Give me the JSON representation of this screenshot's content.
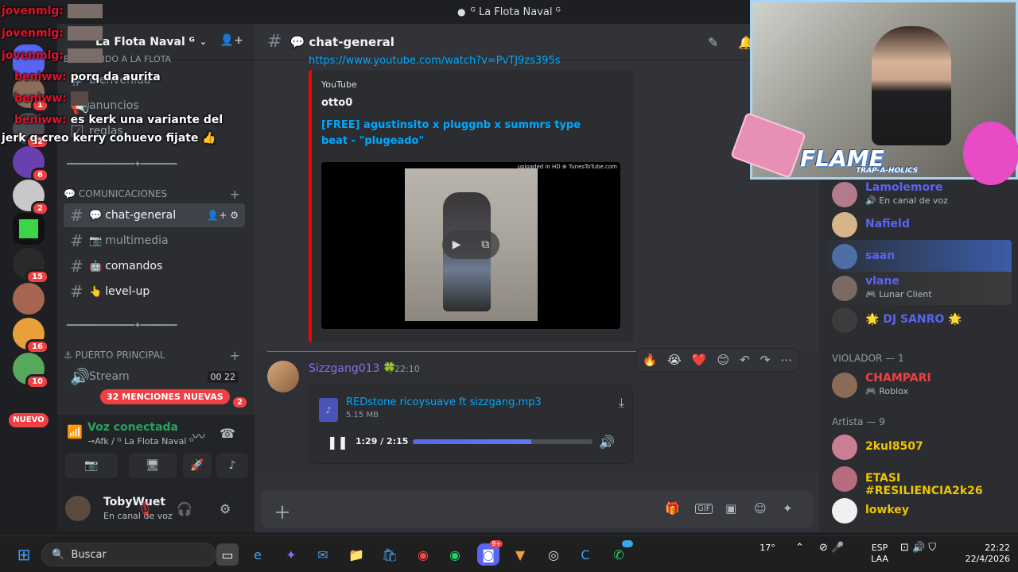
{
  "window": {
    "title": "ᴳ La Flota Naval ᴳ"
  },
  "server": {
    "name": "La Flota Naval ᴳ"
  },
  "guild_badges": [
    "1",
    "32",
    "6",
    "2",
    "15",
    "16",
    "10"
  ],
  "nuevo_label": "NUEVO",
  "sidebar": {
    "welcome_cat": "BIENVENIDO A LA FLOTA",
    "bienvenida": "bienvenida",
    "anuncios": "anuncios",
    "reglas": "reglas",
    "divider1": "━━━━━━━━━━━━━━━✦━━━━━━━━",
    "cat_comunicaciones": "COMUNICACIONES",
    "channels": [
      {
        "emoji": "💬",
        "name": "chat-general"
      },
      {
        "emoji": "📷",
        "name": "multimedia"
      },
      {
        "emoji": "🤖",
        "name": "comandos"
      },
      {
        "emoji": "👆",
        "name": "level-up"
      }
    ],
    "divider2": "━━━━━━━━━━━━━━━✦━━━━━━━━",
    "cat_puerto": "PUERTO PRINCIPAL",
    "stream": "Stream",
    "stream_count_a": "00",
    "stream_count_b": "22",
    "mentions_pill": "32 MENCIONES NUEVAS",
    "voice_badge": "2"
  },
  "voice": {
    "title": "Voz conectada",
    "subtitle": "⊸Afk / ᴳ La Flota Naval ᴳ"
  },
  "user": {
    "name": "TobyWuet",
    "status": "En canal de voz"
  },
  "channel": {
    "name": "chat-general",
    "emoji": "💬"
  },
  "message_top": {
    "link": "https://www.youtube.com/watch?v=PvTJ9zs395s"
  },
  "embed": {
    "provider": "YouTube",
    "author": "otto0",
    "title": "[FREE] agustinsito x pluggnb x summrs type beat - \"plugeado\"",
    "uploaded": "uploaded in HD ⊕ TunesToTube.com"
  },
  "message": {
    "user": "Sizzgang013",
    "badge": "🍀",
    "time": "22:10",
    "reactions": [
      "🔥",
      "😭",
      "❤️",
      "😊",
      "↶",
      "↷",
      "⋯"
    ]
  },
  "audio": {
    "filename": "REDstone ricoysuave ft sizzgang.mp3",
    "size": "5.15 MB",
    "time": "1:29 / 2:15",
    "progress": 0.66
  },
  "members": {
    "list": [
      {
        "name": "Lamolemore",
        "sub": "En canal de voz",
        "color": "#5865f2",
        "av": "#b37a8c"
      },
      {
        "name": "Nafield",
        "sub": "",
        "color": "#5865f2",
        "av": "#d6b58a"
      },
      {
        "name": "saan",
        "sub": "",
        "color": "#5865f2",
        "av": "#4d6fa6"
      },
      {
        "name": "vlane",
        "sub": "Lunar Client",
        "color": "#5865f2",
        "av": "#7b6a64"
      },
      {
        "name": "🌟 DJ SANRO 🌟",
        "sub": "",
        "color": "#5865f2",
        "av": "#3c3c3c"
      }
    ],
    "group_violador": "VIOLADOR — 1",
    "violador": {
      "name": "CHAMPARI",
      "sub": "Roblox"
    },
    "group_artista": "Artista — 9",
    "artistas": [
      {
        "name": "2kul8507",
        "av": "#c97e93"
      },
      {
        "name": "ETASI #RESILIENCIA2k26",
        "av": "#b66b7e"
      },
      {
        "name": "lowkey",
        "av": "#f0f0f0"
      }
    ]
  },
  "webcam": {
    "brand": "FLAME",
    "sub": "TRAP-A-HOLICS"
  },
  "chat_overlay": [
    {
      "name": "jovenmlg:",
      "text": ""
    },
    {
      "name": "jovenmlg:",
      "text": ""
    },
    {
      "name": "jovenmlg:",
      "text": ""
    },
    {
      "name": "beniww:",
      "text": "porq da aurita"
    },
    {
      "name": "beniww:",
      "text": ""
    },
    {
      "name": "beniww:",
      "text": "es kerk una variante del"
    },
    {
      "name": "",
      "text": "jerk q creo kerry cohuevo fijate 👍"
    }
  ],
  "taskbar": {
    "search_placeholder": "Buscar",
    "weather": "17°",
    "lang": "ESP",
    "lang_sub": "LAA",
    "time": "22:22",
    "date": "22/4/2026",
    "discord_badge": "9+",
    "whatsapp_badge": "19"
  }
}
